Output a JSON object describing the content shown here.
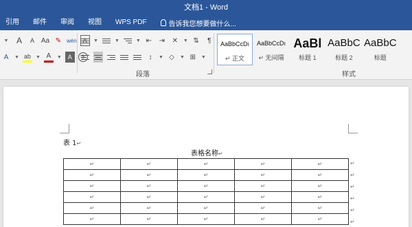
{
  "app": {
    "title": "文档1 - Word"
  },
  "tabs": [
    "引用",
    "邮件",
    "审阅",
    "视图",
    "WPS PDF"
  ],
  "tell_me": "告诉我您想要做什么...",
  "ribbon": {
    "groups": {
      "paragraph": "段落",
      "styles": "样式"
    },
    "font_icons": {
      "grow": "A",
      "shrink": "A",
      "case": "Aa",
      "clear": "✎",
      "phonetic": "wén",
      "border": "A",
      "effects": "A",
      "highlight": "ab",
      "color": "A",
      "shade": "A",
      "circle": "字"
    }
  },
  "styles_gallery": [
    {
      "preview": "AaBbCcDı",
      "name": "正文",
      "prefix": "↵",
      "active": true,
      "size": "small"
    },
    {
      "preview": "AaBbCcDı",
      "name": "无间隔",
      "prefix": "↵",
      "active": false,
      "size": "small"
    },
    {
      "preview": "AaBl",
      "name": "标题 1",
      "prefix": "",
      "active": false,
      "size": "big"
    },
    {
      "preview": "AaBbC",
      "name": "标题 2",
      "prefix": "",
      "active": false,
      "size": "med"
    },
    {
      "preview": "AaBbC",
      "name": "标题",
      "prefix": "",
      "active": false,
      "size": "med"
    }
  ],
  "document": {
    "table_label": "表 1",
    "table_title": "表格名称",
    "para_mark": "↵",
    "rows": [
      [
        "↵",
        "↵",
        "↵",
        "↵",
        "↵"
      ],
      [
        "↵",
        "↵",
        "↵",
        "↵",
        "↵"
      ],
      [
        "↵",
        "↵",
        "↵",
        "↵",
        "↵"
      ],
      [
        "↵",
        "↵",
        "↵",
        "↵",
        "↵"
      ],
      [
        "↵",
        "↵",
        "↵",
        "↵",
        "↵"
      ],
      [
        "↵",
        "↵",
        "↵",
        "↵",
        "↵"
      ]
    ]
  },
  "colors": {
    "accent": "#2b579a",
    "highlight": "#ffff00",
    "font_red": "#c00000"
  }
}
